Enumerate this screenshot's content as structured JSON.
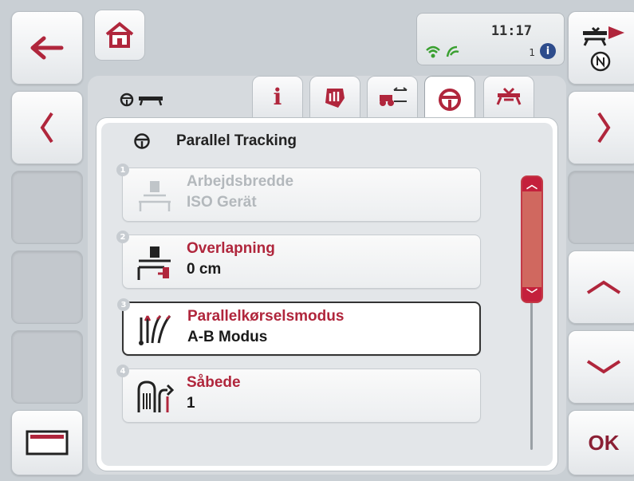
{
  "left_softkeys": [
    "back-arrow",
    "previous-page",
    "empty",
    "empty",
    "empty",
    "card"
  ],
  "right_softkeys": [
    "implement-north",
    "next-page",
    "empty",
    "scroll-up",
    "scroll-down",
    "ok"
  ],
  "ok_label": "OK",
  "status": {
    "time": "11:17",
    "alarm_count": "1",
    "info_badge": "i"
  },
  "tabs": [
    {
      "icon": "info-icon",
      "active": false
    },
    {
      "icon": "isobus-icon",
      "active": false
    },
    {
      "icon": "tractor-width-icon",
      "active": false
    },
    {
      "icon": "steering-wheel-icon",
      "active": true
    },
    {
      "icon": "implement-icon",
      "active": false
    }
  ],
  "title": "Parallel Tracking",
  "items": [
    {
      "num": "1",
      "label": "Arbejdsbredde",
      "value": "ISO Gerät",
      "disabled": true,
      "selected": false
    },
    {
      "num": "2",
      "label": "Overlapning",
      "value": "0 cm",
      "disabled": false,
      "selected": false
    },
    {
      "num": "3",
      "label": "Parallelkørselsmodus",
      "value": "A-B Modus",
      "disabled": false,
      "selected": true
    },
    {
      "num": "4",
      "label": "Såbede",
      "value": "1",
      "disabled": false,
      "selected": false
    }
  ],
  "colors": {
    "accent": "#b0263c",
    "scroll": "#c4203c"
  }
}
